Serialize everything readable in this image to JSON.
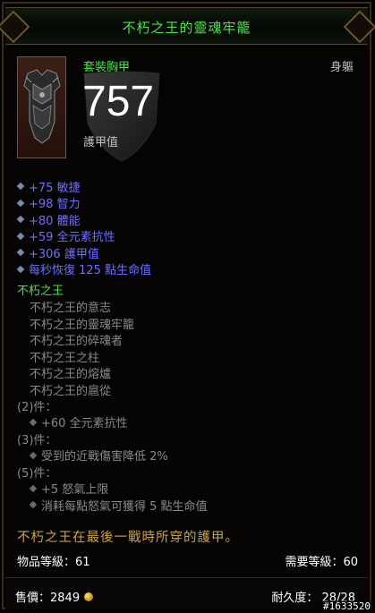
{
  "item": {
    "name": "不朽之王的靈魂牢籠",
    "type": "套裝胸甲",
    "slot": "身軀",
    "armor_value": "757",
    "armor_label": "護甲值",
    "icon": "chest-armor-icon"
  },
  "affixes": [
    "+75 敏捷",
    "+98 智力",
    "+80 體能",
    "+59 全元素抗性",
    "+306 護甲值",
    "每秒恢復 125 點生命值"
  ],
  "set": {
    "name": "不朽之王",
    "pieces": [
      "不朽之王的意志",
      "不朽之王的靈魂牢籠",
      "不朽之王的碎魂者",
      "不朽之王之柱",
      "不朽之王的熔爐",
      "不朽之王的扈從"
    ],
    "bonus2_head": "(2)件：",
    "bonus2": [
      "+60 全元素抗性"
    ],
    "bonus3_head": "(3)件：",
    "bonus3": [
      "受到的近戰傷害降低 2%"
    ],
    "bonus5_head": "(5)件：",
    "bonus5": [
      "+5 怒氣上限",
      "消耗每點怒氣可獲得 5 點生命值"
    ]
  },
  "flavor": "不朽之王在最後一戰時所穿的護甲。",
  "item_level": "物品等級：61",
  "required_level": "需要等級：60",
  "price": "售價：2849",
  "durability": "耐久度：  28/28",
  "watermark": "#1633520",
  "colors": {
    "set_green": "#4ce24c",
    "magic_blue": "#6e6eff",
    "flavor_gold": "#c9a34a",
    "inactive_gray": "#8a8a8a"
  }
}
